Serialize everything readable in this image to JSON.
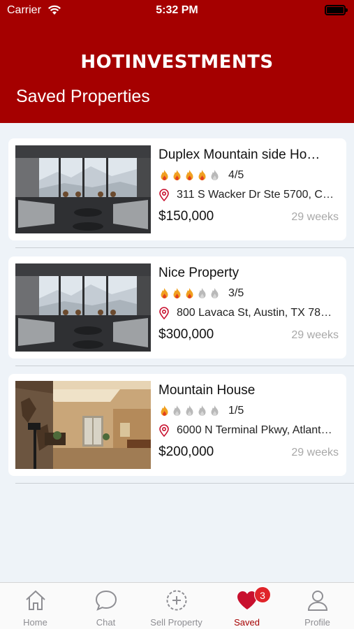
{
  "status_bar": {
    "carrier": "Carrier",
    "time": "5:32 PM"
  },
  "header": {
    "logo": "HOTINVESTMENTS",
    "title": "Saved Properties"
  },
  "properties": [
    {
      "name": "Duplex Mountain side Ho…",
      "rating": 4,
      "rating_text": "4/5",
      "address": "311 S Wacker Dr Ste 5700, C…",
      "price": "$150,000",
      "age": "29 weeks"
    },
    {
      "name": "Nice Property",
      "rating": 3,
      "rating_text": "3/5",
      "address": "800 Lavaca St, Austin, TX 78…",
      "price": "$300,000",
      "age": "29 weeks"
    },
    {
      "name": "Mountain House",
      "rating": 1,
      "rating_text": "1/5",
      "address": "6000 N Terminal Pkwy, Atlant…",
      "price": "$200,000",
      "age": "29 weeks"
    }
  ],
  "tabbar": {
    "tabs": [
      {
        "label": "Home",
        "icon": "home-icon"
      },
      {
        "label": "Chat",
        "icon": "chat-icon"
      },
      {
        "label": "Sell Property",
        "icon": "add-circle-icon"
      },
      {
        "label": "Saved",
        "icon": "heart-icon",
        "badge": "3"
      },
      {
        "label": "Profile",
        "icon": "profile-icon"
      }
    ],
    "active_tab": "Saved"
  },
  "colors": {
    "brand": "#a50000",
    "background": "#eef3f8",
    "badge": "#e0242a",
    "flame_on": "#f0a020",
    "flame_off": "#b9b9b9",
    "muted_text": "#a8a8a8"
  }
}
